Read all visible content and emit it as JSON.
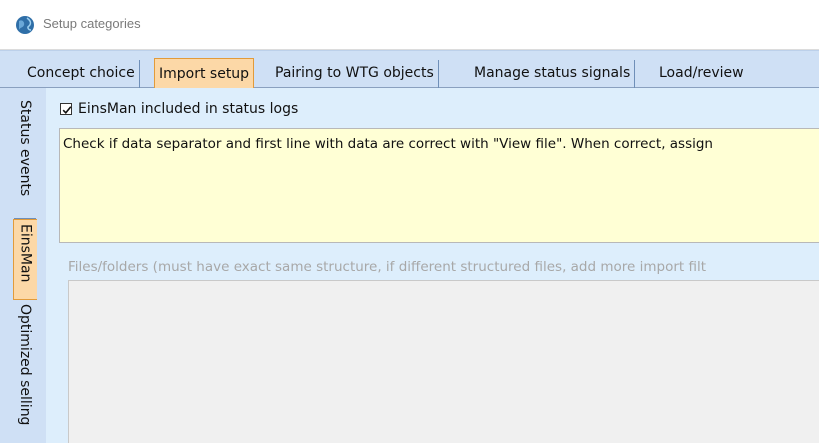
{
  "window": {
    "title": "Setup categories",
    "app_icon": "globe-icon"
  },
  "tabs": [
    {
      "label": "Concept choice",
      "active": false
    },
    {
      "label": "Import setup",
      "active": true
    },
    {
      "label": "Pairing to WTG objects",
      "active": false
    },
    {
      "label": "Manage status signals",
      "active": false
    },
    {
      "label": "Load/review",
      "active": false
    }
  ],
  "side_tabs": [
    {
      "label": "Status events",
      "active": false
    },
    {
      "label": "EinsMan",
      "active": true
    },
    {
      "label": "Optimized selling",
      "active": false
    }
  ],
  "panel": {
    "checkbox_label": "EinsMan included in status logs",
    "checkbox_checked": true,
    "info_text": "Check if data separator and first line with data are correct with \"View file\". When correct, assign",
    "files_label": "Files/folders (must have exact same structure, if different structured files, add more import filt"
  },
  "colors": {
    "tabstrip_bg": "#cfe0f5",
    "active_tab_bg": "#fcd8a7",
    "active_tab_border": "#e29b3a",
    "panel_bg": "#ddeefc",
    "info_bg": "#ffffd5"
  }
}
